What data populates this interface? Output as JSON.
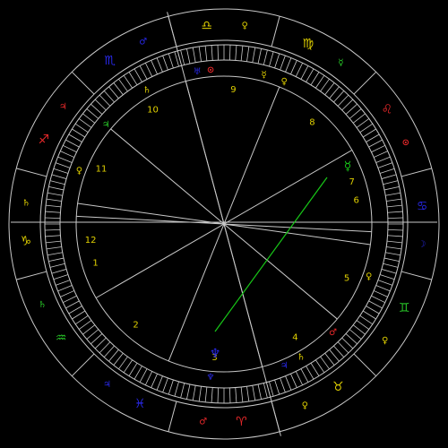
{
  "colors": {
    "background": "#000000",
    "lines": "#c8c8c8",
    "fire": "#e8282a",
    "earth": "#e0d000",
    "air": "#28c828",
    "water": "#2828e8",
    "aspect_green": "#18c818"
  },
  "signs": [
    {
      "name": "libra",
      "glyph": "♎",
      "element": "earth",
      "icon": "libra-icon"
    },
    {
      "name": "virgo",
      "glyph": "♍",
      "element": "earth",
      "icon": "virgo-icon"
    },
    {
      "name": "leo",
      "glyph": "♌",
      "element": "fire",
      "icon": "leo-icon"
    },
    {
      "name": "cancer",
      "glyph": "♋",
      "element": "water",
      "icon": "cancer-icon"
    },
    {
      "name": "gemini",
      "glyph": "♊",
      "element": "air",
      "icon": "gemini-icon"
    },
    {
      "name": "taurus",
      "glyph": "♉",
      "element": "earth",
      "icon": "taurus-icon"
    },
    {
      "name": "aries",
      "glyph": "♈",
      "element": "fire",
      "icon": "aries-icon"
    },
    {
      "name": "pisces",
      "glyph": "♓",
      "element": "water",
      "icon": "pisces-icon"
    },
    {
      "name": "aquarius",
      "glyph": "♒",
      "element": "air",
      "icon": "aquarius-icon"
    },
    {
      "name": "capricorn",
      "glyph": "♑",
      "element": "earth",
      "icon": "capricorn-icon"
    },
    {
      "name": "sagittarius",
      "glyph": "♐",
      "element": "fire",
      "icon": "sagittarius-icon"
    },
    {
      "name": "scorpio",
      "glyph": "♏",
      "element": "water",
      "icon": "scorpio-icon"
    }
  ],
  "rulers": [
    {
      "glyph": "♀",
      "element": "earth",
      "icon": "venus-ruler-icon"
    },
    {
      "glyph": "☿",
      "element": "air",
      "icon": "mercury-ruler-icon"
    },
    {
      "glyph": "⊙",
      "element": "fire",
      "icon": "sun-ruler-icon"
    },
    {
      "glyph": "☽",
      "element": "water",
      "icon": "moon-ruler-icon"
    },
    {
      "glyph": "♀",
      "element": "earth",
      "icon": "venus-ruler-icon-2"
    },
    {
      "glyph": "♀",
      "element": "earth",
      "icon": "venus-ruler-icon-3"
    },
    {
      "glyph": "♂",
      "element": "fire",
      "icon": "mars-ruler-icon"
    },
    {
      "glyph": "♃",
      "element": "water",
      "icon": "jupiter-ruler-icon"
    },
    {
      "glyph": "♄",
      "element": "air",
      "icon": "saturn-ruler-icon"
    },
    {
      "glyph": "♄",
      "element": "earth",
      "icon": "saturn-ruler-icon-2"
    },
    {
      "glyph": "♃",
      "element": "fire",
      "icon": "jupiter-ruler-icon-2"
    },
    {
      "glyph": "♂",
      "element": "water",
      "icon": "mars-ruler-icon-2"
    }
  ],
  "houses": [
    {
      "label": "1"
    },
    {
      "label": "2"
    },
    {
      "label": "3"
    },
    {
      "label": "4"
    },
    {
      "label": "5"
    },
    {
      "label": "6"
    },
    {
      "label": "7"
    },
    {
      "label": "8"
    },
    {
      "label": "9"
    },
    {
      "label": "10"
    },
    {
      "label": "11"
    },
    {
      "label": "12"
    }
  ],
  "planets": [
    {
      "glyph": "♅",
      "element": "water",
      "icon": "uranus-icon"
    },
    {
      "glyph": "⊙",
      "element": "fire",
      "icon": "sun-icon"
    },
    {
      "glyph": "☿",
      "element": "earth",
      "icon": "mercury-icon"
    },
    {
      "glyph": "♀",
      "element": "earth",
      "icon": "venus-icon"
    },
    {
      "glyph": "♆",
      "element": "water",
      "icon": "neptune-icon"
    },
    {
      "glyph": "♃",
      "element": "water",
      "icon": "jupiter-icon"
    },
    {
      "glyph": "♄",
      "element": "earth",
      "icon": "saturn-icon"
    },
    {
      "glyph": "♂",
      "element": "fire",
      "icon": "mars-icon"
    },
    {
      "glyph": "♀",
      "element": "earth",
      "icon": "venus-icon-2"
    },
    {
      "glyph": "♃",
      "element": "air",
      "icon": "jupiter-icon-2"
    },
    {
      "glyph": "♄",
      "element": "earth",
      "icon": "saturn-icon-2"
    },
    {
      "glyph": "♀",
      "element": "earth",
      "icon": "venus-icon-3"
    }
  ]
}
